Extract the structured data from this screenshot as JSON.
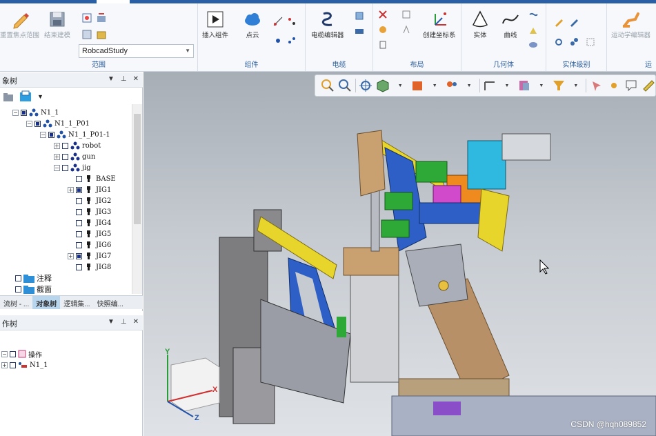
{
  "ribbon": {
    "groups": [
      {
        "label": "范围",
        "buttons": [
          "重置焦点范围",
          "结束建模"
        ],
        "dropdown_value": "RobcadStudy"
      },
      {
        "label": "组件",
        "buttons": [
          "插入组件",
          "点云"
        ]
      },
      {
        "label": "电缆",
        "buttons": [
          "电缆编辑器"
        ]
      },
      {
        "label": "布局",
        "buttons": [
          "创建坐标系"
        ]
      },
      {
        "label": "几何体",
        "buttons": [
          "实体",
          "曲线"
        ]
      },
      {
        "label": "实体级别",
        "buttons": []
      },
      {
        "label": "运",
        "buttons": [
          "运动学编辑器"
        ]
      }
    ]
  },
  "object_tree": {
    "title": "象树",
    "nodes": [
      {
        "label": "N1_1",
        "level": 0,
        "expander": "−",
        "check": "full"
      },
      {
        "label": "N1_1_P01",
        "level": 1,
        "expander": "−",
        "check": "full"
      },
      {
        "label": "N1_1_P01-1",
        "level": 2,
        "expander": "−",
        "check": "full"
      },
      {
        "label": "robot",
        "level": 3,
        "expander": "+",
        "check": "empty"
      },
      {
        "label": "gun",
        "level": 3,
        "expander": "+",
        "check": "empty"
      },
      {
        "label": "jig",
        "level": 3,
        "expander": "−",
        "check": "empty"
      },
      {
        "label": "BASE",
        "level": 4,
        "expander": "",
        "check": "empty"
      },
      {
        "label": "JIG1",
        "level": 4,
        "expander": "+",
        "check": "full"
      },
      {
        "label": "JIG2",
        "level": 4,
        "expander": "",
        "check": "empty"
      },
      {
        "label": "JIG3",
        "level": 4,
        "expander": "",
        "check": "empty"
      },
      {
        "label": "JIG4",
        "level": 4,
        "expander": "",
        "check": "empty"
      },
      {
        "label": "JIG5",
        "level": 4,
        "expander": "",
        "check": "empty"
      },
      {
        "label": "JIG6",
        "level": 4,
        "expander": "",
        "check": "empty"
      },
      {
        "label": "JIG7",
        "level": 4,
        "expander": "+",
        "check": "full"
      },
      {
        "label": "JIG8",
        "level": 4,
        "expander": "",
        "check": "empty"
      }
    ],
    "folders": [
      {
        "label": "注释"
      },
      {
        "label": "截面"
      }
    ],
    "tabs": [
      "流树 - ...",
      "对象树",
      "逻辑集...",
      "快照编..."
    ],
    "active_tab": 1
  },
  "operation_tree": {
    "title": "作树",
    "nodes": [
      {
        "label": "操作"
      },
      {
        "label": "N1_1"
      }
    ]
  },
  "viewport": {
    "triad": {
      "x": "X",
      "y": "Y",
      "z": "Z"
    },
    "watermark": "CSDN @hqh089852"
  }
}
